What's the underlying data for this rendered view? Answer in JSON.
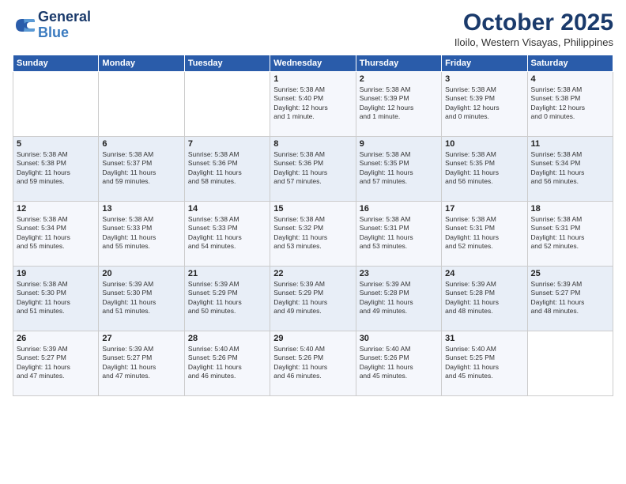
{
  "header": {
    "logo_line1": "General",
    "logo_line2": "Blue",
    "title": "October 2025",
    "subtitle": "Iloilo, Western Visayas, Philippines"
  },
  "weekdays": [
    "Sunday",
    "Monday",
    "Tuesday",
    "Wednesday",
    "Thursday",
    "Friday",
    "Saturday"
  ],
  "weeks": [
    [
      {
        "day": "",
        "text": ""
      },
      {
        "day": "",
        "text": ""
      },
      {
        "day": "",
        "text": ""
      },
      {
        "day": "1",
        "text": "Sunrise: 5:38 AM\nSunset: 5:40 PM\nDaylight: 12 hours\nand 1 minute."
      },
      {
        "day": "2",
        "text": "Sunrise: 5:38 AM\nSunset: 5:39 PM\nDaylight: 12 hours\nand 1 minute."
      },
      {
        "day": "3",
        "text": "Sunrise: 5:38 AM\nSunset: 5:39 PM\nDaylight: 12 hours\nand 0 minutes."
      },
      {
        "day": "4",
        "text": "Sunrise: 5:38 AM\nSunset: 5:38 PM\nDaylight: 12 hours\nand 0 minutes."
      }
    ],
    [
      {
        "day": "5",
        "text": "Sunrise: 5:38 AM\nSunset: 5:38 PM\nDaylight: 11 hours\nand 59 minutes."
      },
      {
        "day": "6",
        "text": "Sunrise: 5:38 AM\nSunset: 5:37 PM\nDaylight: 11 hours\nand 59 minutes."
      },
      {
        "day": "7",
        "text": "Sunrise: 5:38 AM\nSunset: 5:36 PM\nDaylight: 11 hours\nand 58 minutes."
      },
      {
        "day": "8",
        "text": "Sunrise: 5:38 AM\nSunset: 5:36 PM\nDaylight: 11 hours\nand 57 minutes."
      },
      {
        "day": "9",
        "text": "Sunrise: 5:38 AM\nSunset: 5:35 PM\nDaylight: 11 hours\nand 57 minutes."
      },
      {
        "day": "10",
        "text": "Sunrise: 5:38 AM\nSunset: 5:35 PM\nDaylight: 11 hours\nand 56 minutes."
      },
      {
        "day": "11",
        "text": "Sunrise: 5:38 AM\nSunset: 5:34 PM\nDaylight: 11 hours\nand 56 minutes."
      }
    ],
    [
      {
        "day": "12",
        "text": "Sunrise: 5:38 AM\nSunset: 5:34 PM\nDaylight: 11 hours\nand 55 minutes."
      },
      {
        "day": "13",
        "text": "Sunrise: 5:38 AM\nSunset: 5:33 PM\nDaylight: 11 hours\nand 55 minutes."
      },
      {
        "day": "14",
        "text": "Sunrise: 5:38 AM\nSunset: 5:33 PM\nDaylight: 11 hours\nand 54 minutes."
      },
      {
        "day": "15",
        "text": "Sunrise: 5:38 AM\nSunset: 5:32 PM\nDaylight: 11 hours\nand 53 minutes."
      },
      {
        "day": "16",
        "text": "Sunrise: 5:38 AM\nSunset: 5:31 PM\nDaylight: 11 hours\nand 53 minutes."
      },
      {
        "day": "17",
        "text": "Sunrise: 5:38 AM\nSunset: 5:31 PM\nDaylight: 11 hours\nand 52 minutes."
      },
      {
        "day": "18",
        "text": "Sunrise: 5:38 AM\nSunset: 5:31 PM\nDaylight: 11 hours\nand 52 minutes."
      }
    ],
    [
      {
        "day": "19",
        "text": "Sunrise: 5:38 AM\nSunset: 5:30 PM\nDaylight: 11 hours\nand 51 minutes."
      },
      {
        "day": "20",
        "text": "Sunrise: 5:39 AM\nSunset: 5:30 PM\nDaylight: 11 hours\nand 51 minutes."
      },
      {
        "day": "21",
        "text": "Sunrise: 5:39 AM\nSunset: 5:29 PM\nDaylight: 11 hours\nand 50 minutes."
      },
      {
        "day": "22",
        "text": "Sunrise: 5:39 AM\nSunset: 5:29 PM\nDaylight: 11 hours\nand 49 minutes."
      },
      {
        "day": "23",
        "text": "Sunrise: 5:39 AM\nSunset: 5:28 PM\nDaylight: 11 hours\nand 49 minutes."
      },
      {
        "day": "24",
        "text": "Sunrise: 5:39 AM\nSunset: 5:28 PM\nDaylight: 11 hours\nand 48 minutes."
      },
      {
        "day": "25",
        "text": "Sunrise: 5:39 AM\nSunset: 5:27 PM\nDaylight: 11 hours\nand 48 minutes."
      }
    ],
    [
      {
        "day": "26",
        "text": "Sunrise: 5:39 AM\nSunset: 5:27 PM\nDaylight: 11 hours\nand 47 minutes."
      },
      {
        "day": "27",
        "text": "Sunrise: 5:39 AM\nSunset: 5:27 PM\nDaylight: 11 hours\nand 47 minutes."
      },
      {
        "day": "28",
        "text": "Sunrise: 5:40 AM\nSunset: 5:26 PM\nDaylight: 11 hours\nand 46 minutes."
      },
      {
        "day": "29",
        "text": "Sunrise: 5:40 AM\nSunset: 5:26 PM\nDaylight: 11 hours\nand 46 minutes."
      },
      {
        "day": "30",
        "text": "Sunrise: 5:40 AM\nSunset: 5:26 PM\nDaylight: 11 hours\nand 45 minutes."
      },
      {
        "day": "31",
        "text": "Sunrise: 5:40 AM\nSunset: 5:25 PM\nDaylight: 11 hours\nand 45 minutes."
      },
      {
        "day": "",
        "text": ""
      }
    ]
  ]
}
